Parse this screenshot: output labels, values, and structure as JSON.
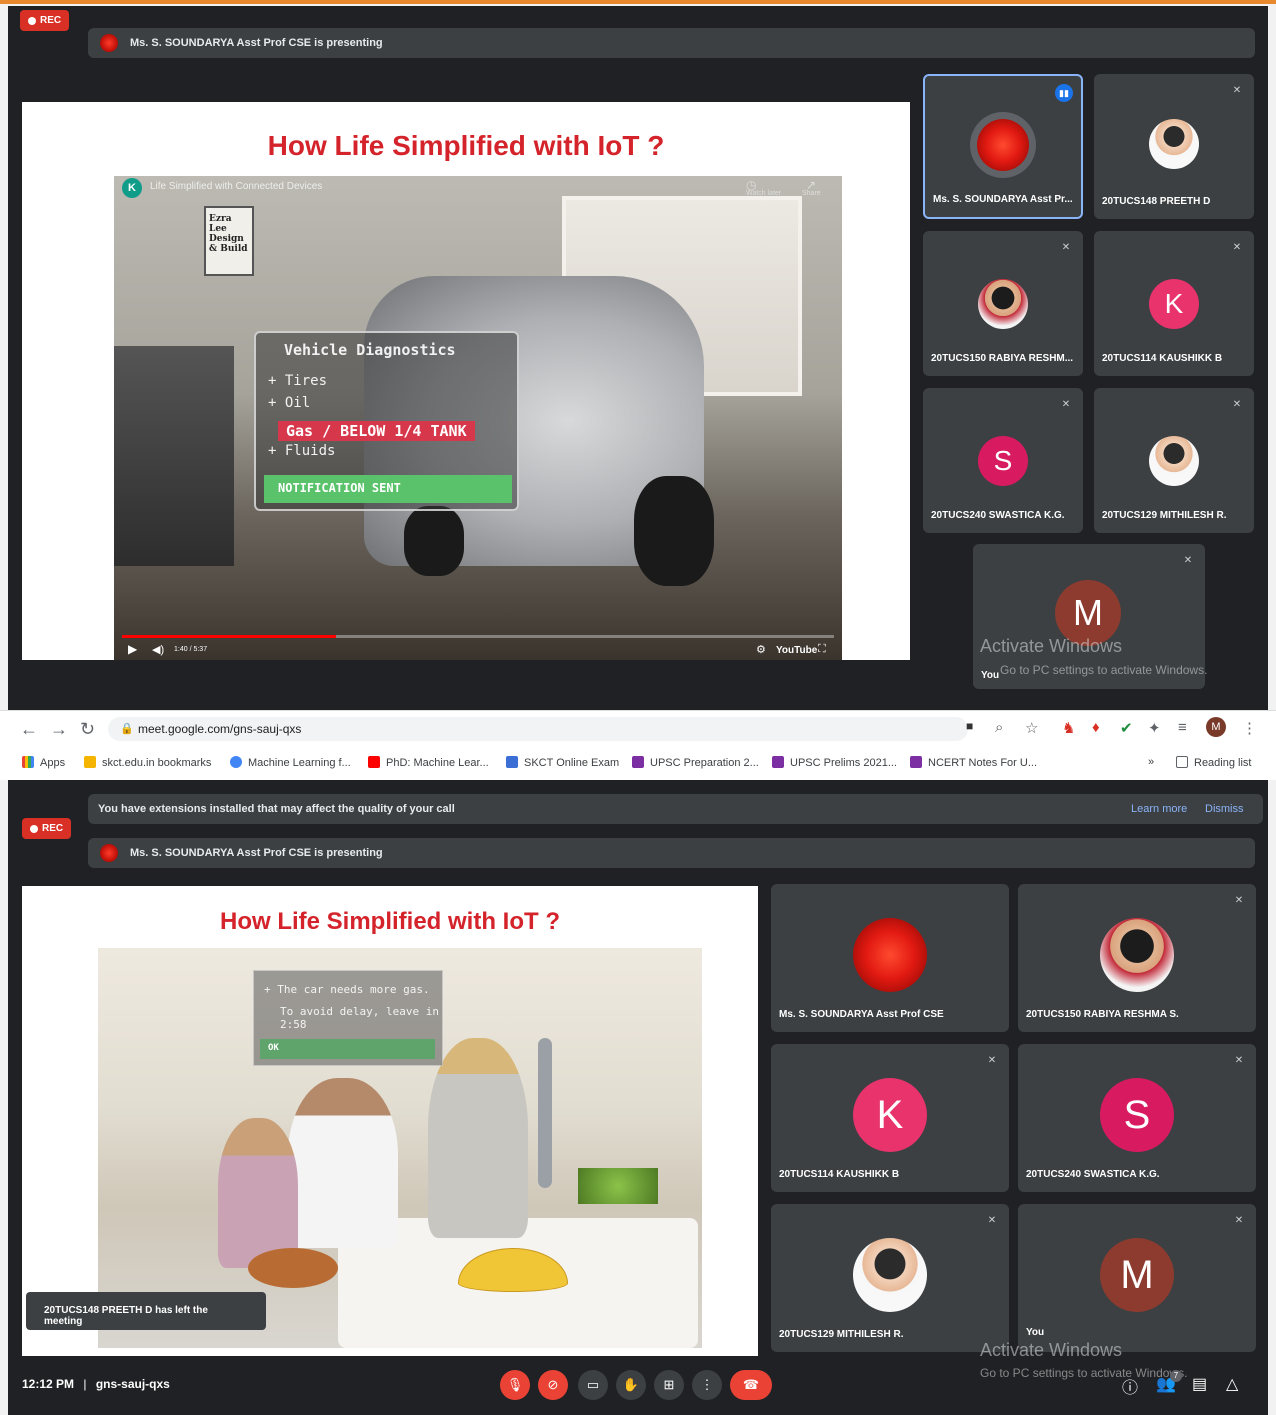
{
  "colors": {
    "meet_bg": "#202124",
    "tile_bg": "#3c4043",
    "rec_red": "#d93025",
    "slide_title": "#d4232a",
    "active_border": "#8ab4f8",
    "avatar_pink": "#e8336d",
    "avatar_magenta": "#d81b60",
    "avatar_brown": "#8d3b2f"
  },
  "top_meet": {
    "rec_label": "REC",
    "presenting_text": "Ms. S. SOUNDARYA Asst Prof CSE is presenting",
    "slide_title": "How Life Simplified with IoT ?",
    "video": {
      "title": "Life Simplified with Connected Devices",
      "channel_initial": "K",
      "watch_later": "Watch later",
      "share": "Share",
      "time": "1:40 / 5:37",
      "youtube": "YouTube",
      "progress_fraction": 0.3,
      "sign_text": "Ezra Lee Design & Build",
      "panel": {
        "title": "Vehicle Diagnostics",
        "items": [
          "Tires",
          "Oil",
          "Fluids"
        ],
        "alert": "Gas / BELOW 1/4 TANK",
        "notify": "NOTIFICATION SENT"
      }
    },
    "tiles": [
      {
        "name": "Ms. S. SOUNDARYA Asst Pr...",
        "avatar_type": "flower",
        "speaking": true
      },
      {
        "name": "20TUCS148 PREETH D",
        "avatar_type": "photo-m"
      },
      {
        "name": "20TUCS150 RABIYA RESHM...",
        "avatar_type": "photo-f"
      },
      {
        "name": "20TUCS114 KAUSHIKK B",
        "avatar_letter": "K"
      },
      {
        "name": "20TUCS240 SWASTICA K.G.",
        "avatar_letter": "S"
      },
      {
        "name": "20TUCS129 MITHILESH R.",
        "avatar_type": "photo-m"
      },
      {
        "name": "You",
        "avatar_letter": "M"
      }
    ],
    "watermark_title": "Activate Windows",
    "watermark_sub": "Go to PC settings to activate Windows."
  },
  "browser": {
    "url": "meet.google.com/gns-sauj-qxs",
    "profile_initial": "M",
    "bookmarks": [
      "Apps",
      "skct.edu.in bookmarks",
      "Machine Learning f...",
      "PhD: Machine Lear...",
      "SKCT Online Exam",
      "UPSC Preparation 2...",
      "UPSC Prelims 2021...",
      "NCERT Notes For U..."
    ],
    "more": "»",
    "reading_list": "Reading list"
  },
  "bottom_meet": {
    "banner_text": "You have extensions installed that may affect the quality of your call",
    "learn_more": "Learn more",
    "dismiss": "Dismiss",
    "rec_label": "REC",
    "presenting_text": "Ms. S. SOUNDARYA Asst Prof CSE is presenting",
    "slide_title": "How Life Simplified with IoT ?",
    "video_panel": {
      "line1": "The car needs more gas.",
      "line2": "To avoid delay, leave in 2:58",
      "ok": "OK"
    },
    "toast": "20TUCS148 PREETH D has left the meeting",
    "tiles": [
      {
        "name": "Ms. S. SOUNDARYA Asst Prof CSE",
        "avatar_type": "flower"
      },
      {
        "name": "20TUCS150 RABIYA RESHMA S.",
        "avatar_type": "photo-f"
      },
      {
        "name": "20TUCS114 KAUSHIKK B",
        "avatar_letter": "K"
      },
      {
        "name": "20TUCS240 SWASTICA K.G.",
        "avatar_letter": "S"
      },
      {
        "name": "20TUCS129 MITHILESH R.",
        "avatar_type": "photo-m"
      },
      {
        "name": "You",
        "avatar_letter": "M"
      }
    ],
    "time": "12:12 PM",
    "separator": "|",
    "meeting_code": "gns-sauj-qxs",
    "participants_count": "7",
    "watermark_title": "Activate Windows",
    "watermark_sub": "Go to PC settings to activate Windows."
  }
}
